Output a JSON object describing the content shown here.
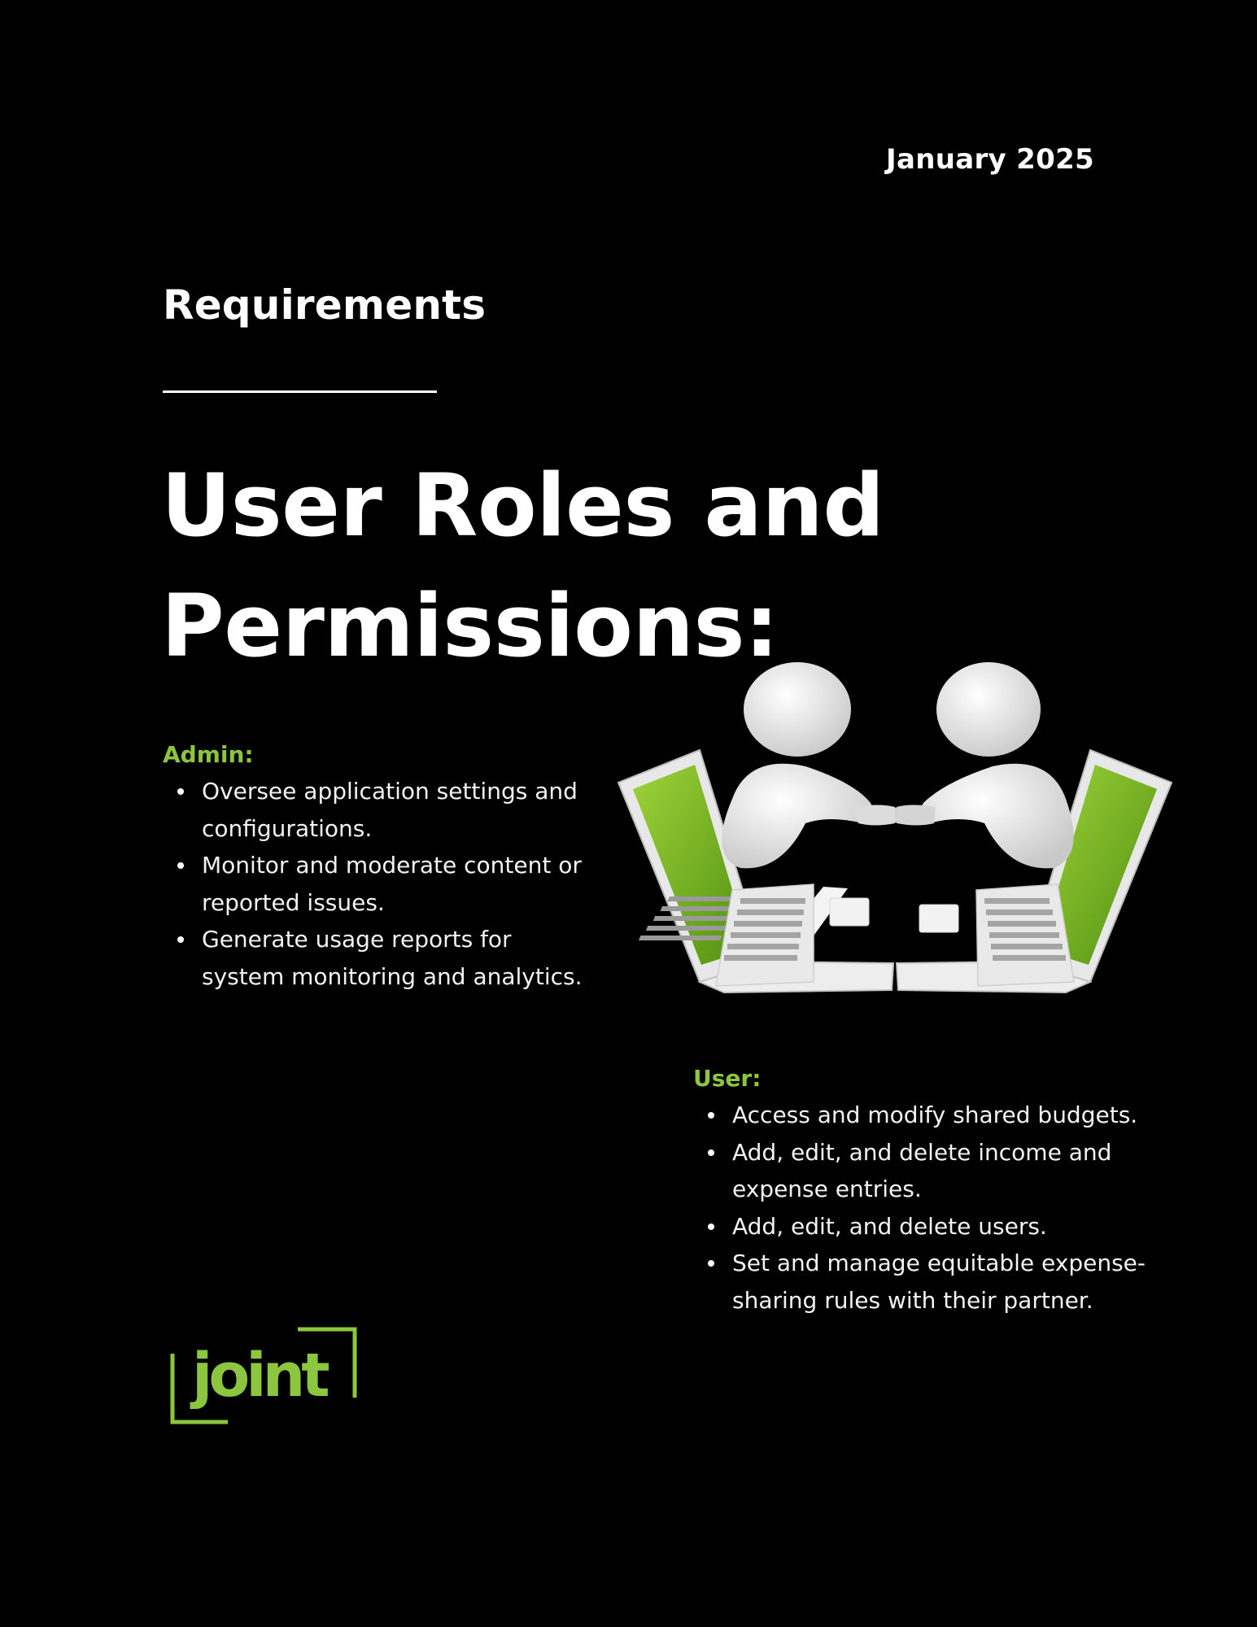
{
  "header": {
    "date": "January 2025"
  },
  "section": {
    "label": "Requirements"
  },
  "title": {
    "line1": "User Roles and",
    "line2": "Permissions:"
  },
  "roles": {
    "admin": {
      "heading": "Admin:",
      "items": [
        "Oversee application settings and configurations.",
        "Monitor and moderate content or reported issues.",
        "Generate usage reports for system monitoring and analytics."
      ]
    },
    "user": {
      "heading": "User:",
      "items": [
        "Access and modify shared budgets.",
        "Add, edit, and delete income and expense entries.",
        "Add, edit, and delete users.",
        "Set and manage equitable expense-sharing rules with their partner."
      ]
    }
  },
  "logo": {
    "text": "joint"
  },
  "colors": {
    "background": "#000000",
    "text": "#ffffff",
    "accent": "#8cc63f"
  },
  "icons": {
    "illustration": "handshake-laptops-illustration",
    "logo": "joint-logo"
  }
}
